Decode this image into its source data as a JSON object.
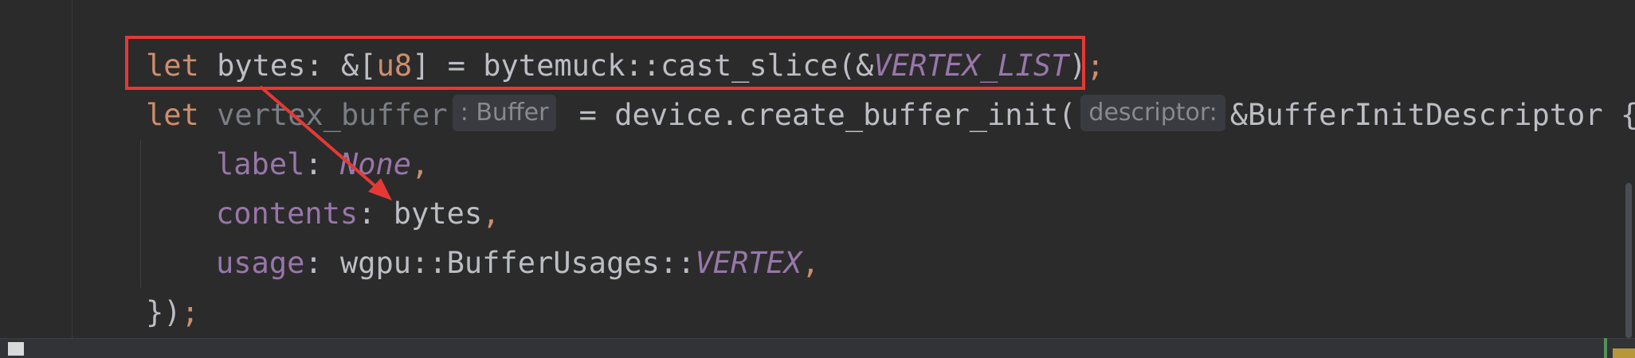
{
  "colors": {
    "background": "#2b2b2b",
    "keyword": "#cf8e6d",
    "text": "#bcbec4",
    "static_constant": "#9876aa",
    "hint_background": "#393b40",
    "hint_text": "#868a91",
    "highlight_box": "#e53935",
    "arrow": "#e53935"
  },
  "code": {
    "line1": {
      "kw_let": "let",
      "text_a": " bytes: &[",
      "type_u8": "u8",
      "text_b": "] = bytemuck::cast_slice(&",
      "const": "VERTEX_LIST",
      "text_c": ")",
      "semicolon": ";"
    },
    "line2": {
      "kw_let": "let",
      "var": " vertex_buffer",
      "type_hint": ": Buffer",
      "text_a": " = device.create_buffer_init(",
      "param_hint": "descriptor:",
      "text_b": "&BufferInitDescriptor {"
    },
    "line3": {
      "field": "label",
      "colon": ": ",
      "value": "None",
      "comma": ","
    },
    "line4": {
      "field": "contents",
      "colon": ": ",
      "value": "bytes",
      "comma": ","
    },
    "line5": {
      "field": "usage",
      "text_a": ": wgpu::BufferUsages::",
      "const": "VERTEX",
      "comma": ","
    },
    "line6": {
      "text": "})",
      "semicolon": ";"
    }
  },
  "annotations": {
    "highlight": "red-rectangle",
    "arrow": "red-arrow"
  }
}
